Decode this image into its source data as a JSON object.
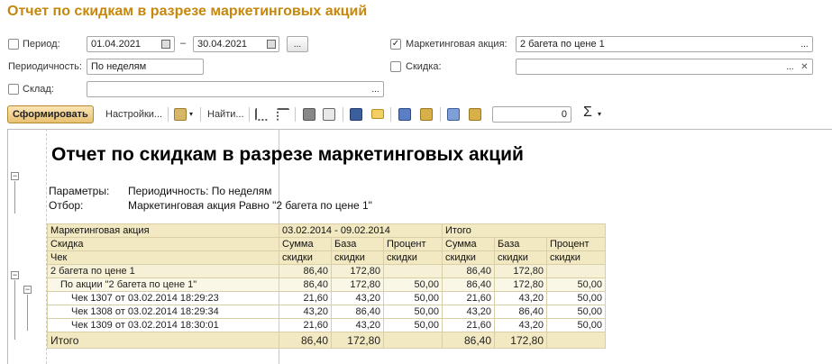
{
  "window": {
    "title": "Отчет по скидкам в разрезе маркетинговых акций"
  },
  "filters": {
    "period": {
      "label": "Период:",
      "checked": false,
      "from": "01.04.2021",
      "dash": "–",
      "to": "30.04.2021",
      "ellipsis": "..."
    },
    "periodicity": {
      "label": "Периодичность:",
      "value": "По неделям"
    },
    "warehouse": {
      "label": "Склад:",
      "checked": false,
      "value": "",
      "ellipsis": "..."
    },
    "marketing_action": {
      "label": "Маркетинговая акция:",
      "checked": true,
      "value": "2 багета по цене 1",
      "ellipsis": "..."
    },
    "discount": {
      "label": "Скидка:",
      "checked": false,
      "value": "",
      "ellipsis": "...",
      "clear": "✕"
    }
  },
  "toolbar": {
    "generate": "Сформировать",
    "settings": "Настройки...",
    "find": "Найти...",
    "counter": "0",
    "sigma": "Σ"
  },
  "report": {
    "title": "Отчет по скидкам в разрезе маркетинговых акций",
    "params_label": "Параметры:",
    "params_value": "Периодичность: По неделям",
    "filter_label": "Отбор:",
    "filter_value": "Маркетинговая акция Равно \"2 багета по цене 1\"",
    "header": {
      "col_action": "Маркетинговая акция",
      "col_discount": "Скидка",
      "col_check": "Чек",
      "period": "03.02.2014 - 09.02.2014",
      "total": "Итого",
      "sum1": "Сумма",
      "sum2": "скидки",
      "base1": "База",
      "base2": "скидки",
      "pct1": "Процент",
      "pct2": "скидки"
    },
    "rows": [
      {
        "name": "2 багета по цене 1",
        "s1": "86,40",
        "b1": "172,80",
        "p1": "",
        "s2": "86,40",
        "b2": "172,80",
        "p2": ""
      },
      {
        "name": "По акции \"2 багета по цене 1\"",
        "s1": "86,40",
        "b1": "172,80",
        "p1": "50,00",
        "s2": "86,40",
        "b2": "172,80",
        "p2": "50,00"
      },
      {
        "name": "Чек 1307 от 03.02.2014 18:29:23",
        "s1": "21,60",
        "b1": "43,20",
        "p1": "50,00",
        "s2": "21,60",
        "b2": "43,20",
        "p2": "50,00"
      },
      {
        "name": "Чек 1308 от 03.02.2014 18:29:34",
        "s1": "43,20",
        "b1": "86,40",
        "p1": "50,00",
        "s2": "43,20",
        "b2": "86,40",
        "p2": "50,00"
      },
      {
        "name": "Чек 1309 от 03.02.2014 18:30:01",
        "s1": "21,60",
        "b1": "43,20",
        "p1": "50,00",
        "s2": "21,60",
        "b2": "43,20",
        "p2": "50,00"
      }
    ],
    "total": {
      "name": "Итого",
      "s1": "86,40",
      "b1": "172,80",
      "p1": "",
      "s2": "86,40",
      "b2": "172,80",
      "p2": ""
    }
  },
  "tree": {
    "collapse": "−"
  }
}
